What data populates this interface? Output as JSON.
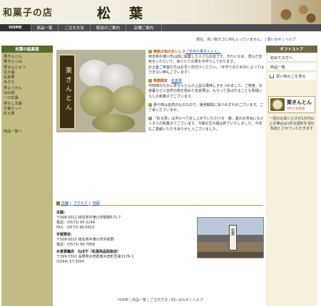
{
  "header": {
    "logo_text": "和菓子の店",
    "brand_text": "松葉"
  },
  "nav": {
    "home": "HOME",
    "items": [
      "商品一覧",
      "ご注文方法",
      "配送のご案内",
      "店舗ご案内"
    ]
  },
  "utility": {
    "text": "現在、買い物カゴに何も入っていません。",
    "links": [
      "問い合せ",
      "ヘルプ"
    ]
  },
  "left_sidebar": {
    "title": "松葉の銘菓選",
    "items": [
      "栗きんとん",
      "栗きんつば",
      "栗まんじゅう",
      "豆大福",
      "名倉栗",
      "あきち",
      "栗ようかん",
      "仙の岡",
      "一口羊羹",
      "栗もし羊羹",
      "羊羹セット",
      "彩る栗"
    ],
    "next": "商品一覧へ"
  },
  "right_sidebar": {
    "title": "ギフトストア",
    "links": [
      "初めての方へ",
      "商品一覧"
    ],
    "cart": "買い物かごを見る",
    "promo_title": "栗きんとん",
    "promo_sub": "9月上旬発売",
    "note": "一回のお買い上げが1万円以上の場合は1件の送料を当社負担とさせていただきます"
  },
  "hero": {
    "scroll_text": "栗きんとん"
  },
  "intro": {
    "p1_head": "晩秋の旬のおいしさ",
    "p1_link": "「手作り栗きんとん」",
    "p1_body": "岐阜県中津川市山間に開業した小さなお店です。きれいな水、澄んだ空気をいただいて、採りたての栗を手作りしております。",
    "p1_note": "お土産ご希望の方はお早く仰付けください。（手作りのため日によってはできない時もございます）",
    "p2_head": "季節限定",
    "p2_link": "名倉栗",
    "p2_body": "市田柿のなかに栗きんとんの上品な風味しきをつめました。ご贈答、お歳暮などに自然の贈を極めた名倉栗は、もらって喜ばれることも間違いなしの和菓子でございます。",
    "p3_body": "栗や柿は自然のものなので、販売期間に多少のずれがございます。ご了承くださいませ。",
    "p4_body": "「彩る栗」は浮かべて召し上がりいただける　春、夏のお茶会にもピッタリの和菓子でございます。今期の豆大福は終了いたしました。今年もご愛顧いただきありがとうございました。"
  },
  "tabs": {
    "items": [
      "店舗",
      "アクセス",
      "地図"
    ]
  },
  "address": {
    "main_title": "本舗：",
    "main_addr": "〒508-0011 岐阜県中津川市駒場571-7",
    "main_tel": "電話：(0573) 65-2244",
    "main_fax": "FAX：(0573) 66-5810",
    "branch_title": "手賀野店：",
    "branch_addr": "〒508-0015 岐阜県中津川市手賀野",
    "branch_tel": "電話：(0573) 66-7858",
    "shop_title": "木曽妻籠店　ねぼや（松葉商品取扱店）",
    "shop_addr": "〒399-5302 長野県木曽郡南木曽町吾妻2176-1",
    "shop_tel": "(0264) 57-3054",
    "store_sign": "松葉"
  },
  "footer": {
    "items": [
      "HOME",
      "商品一覧",
      "ご注文方法",
      "問い合わせ",
      "ヘルプ"
    ]
  }
}
